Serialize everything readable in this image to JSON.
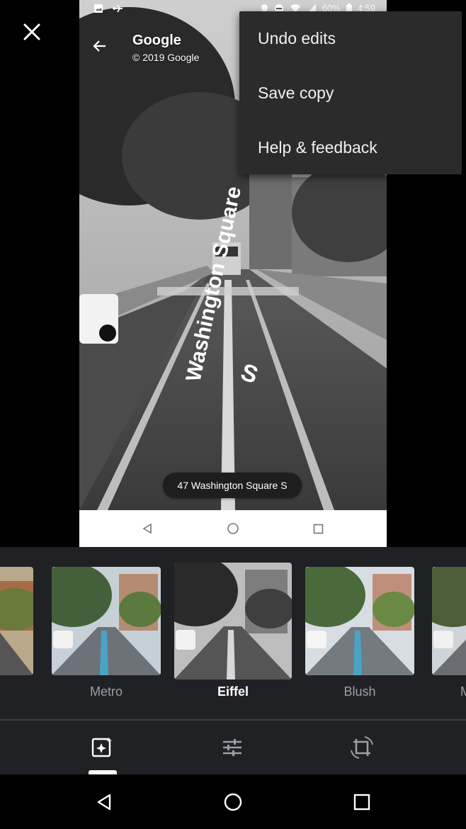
{
  "status_bar": {
    "battery": "60%",
    "time": "4:59"
  },
  "street_view": {
    "title": "Google",
    "copyright": "© 2019 Google",
    "address": "47 Washington Square S",
    "street_label": "Washington Square",
    "direction": "S"
  },
  "overflow_menu": {
    "items": [
      {
        "label": "Undo edits"
      },
      {
        "label": "Save copy"
      },
      {
        "label": "Help & feedback"
      }
    ]
  },
  "filters": {
    "items": [
      {
        "label": ""
      },
      {
        "label": "Metro"
      },
      {
        "label": "Eiffel"
      },
      {
        "label": "Blush"
      },
      {
        "label": "M"
      }
    ],
    "selected": "Eiffel"
  },
  "toolbar": {
    "tools": [
      {
        "icon": "auto-enhance-icon"
      },
      {
        "icon": "adjust-sliders-icon"
      },
      {
        "icon": "crop-rotate-icon"
      }
    ],
    "active": "auto-enhance-icon"
  },
  "colors": {
    "strip_bg": "#202124",
    "menu_bg": "#2b2b2b",
    "label_inactive": "#9aa0a6",
    "label_active": "#ffffff"
  }
}
